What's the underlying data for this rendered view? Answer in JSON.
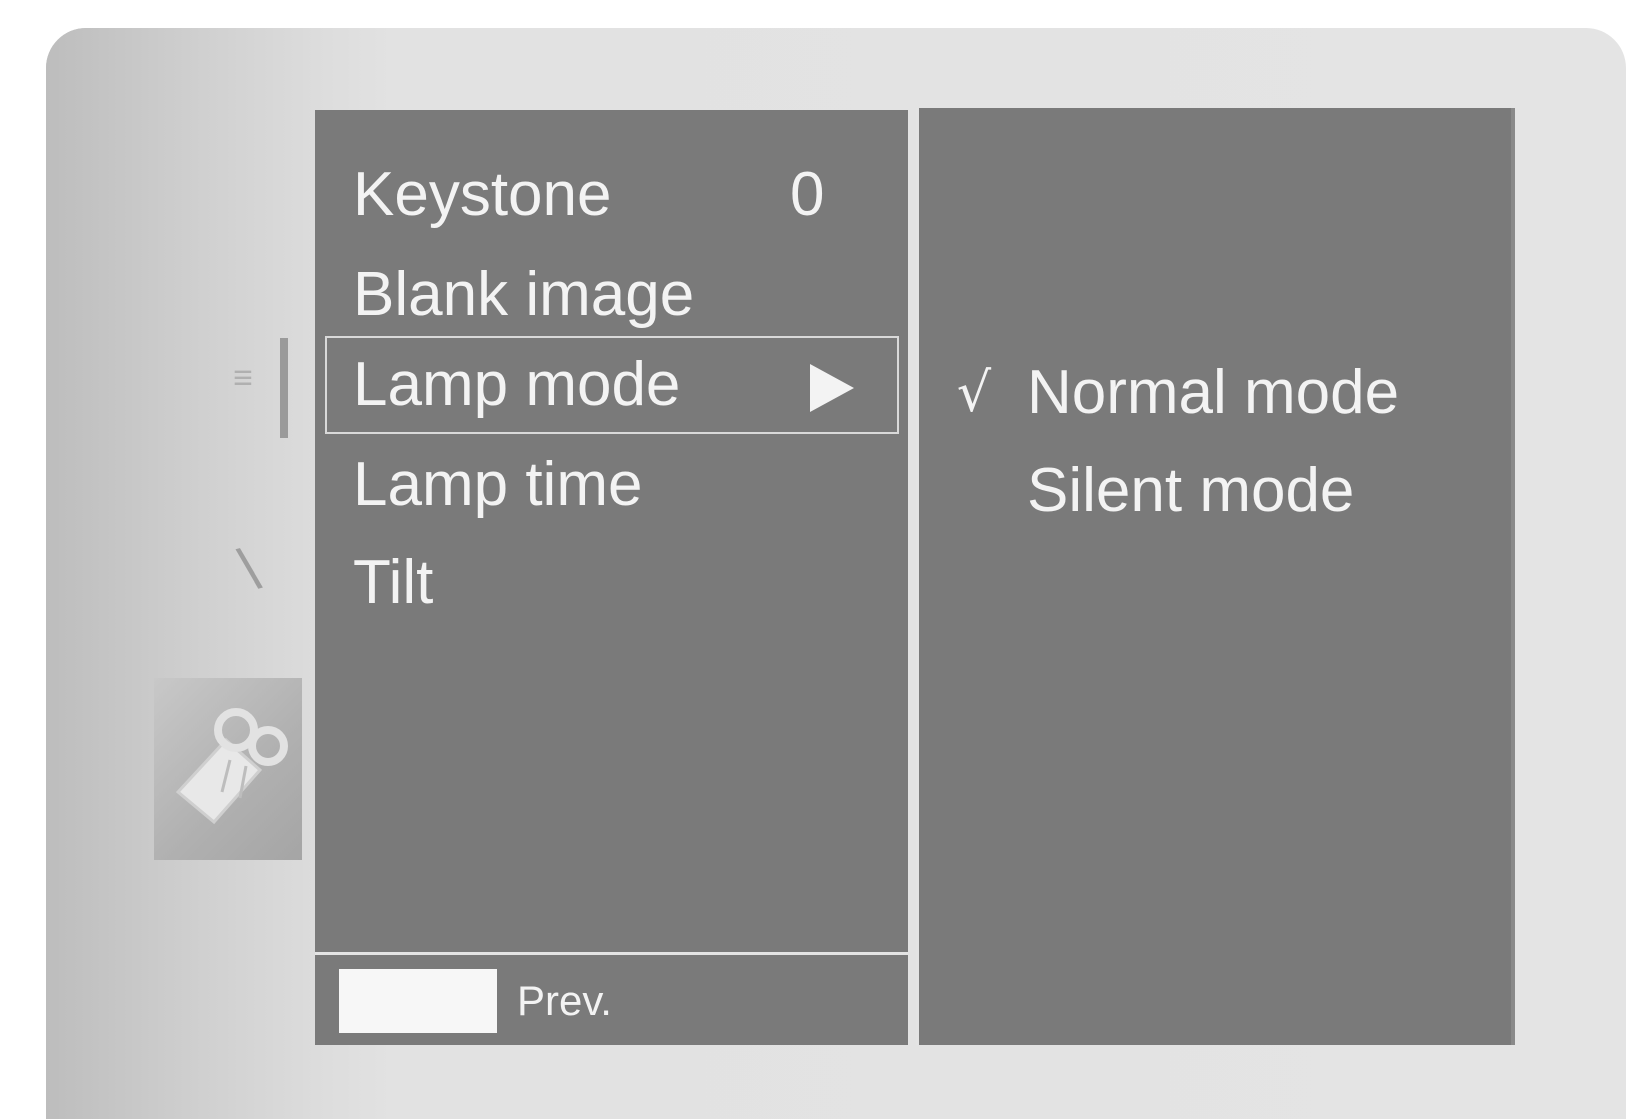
{
  "main_menu": {
    "items": [
      {
        "label": "Keystone",
        "value": "0",
        "selected": false
      },
      {
        "label": "Blank image",
        "value": "",
        "selected": false
      },
      {
        "label": "Lamp mode",
        "value": "",
        "selected": true,
        "submenu_indicator": "arrow-right-icon"
      },
      {
        "label": "Lamp time",
        "value": "",
        "selected": false
      },
      {
        "label": "Tilt",
        "value": "",
        "selected": false
      }
    ],
    "footer": {
      "key_color": "#f7f7f7",
      "label": "Prev."
    }
  },
  "submenu": {
    "options": [
      {
        "label": "Normal mode",
        "check": "√",
        "checked": true
      },
      {
        "label": "Silent mode",
        "check": "",
        "checked": false
      }
    ]
  },
  "side_tabs": {
    "active_icon": "projector-icon"
  },
  "colors": {
    "panel": "#7a7a7a",
    "frame": "#e4e4e4",
    "text": "#f3f3f3"
  }
}
